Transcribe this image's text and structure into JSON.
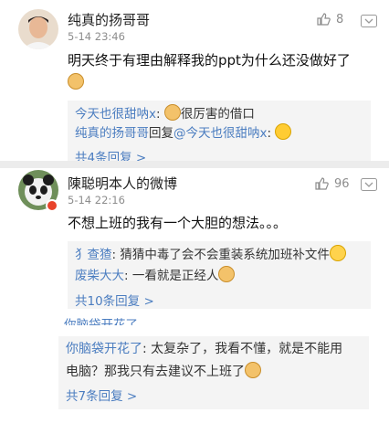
{
  "comments": [
    {
      "name": "纯真的扬哥哥",
      "date": "5-14 23:46",
      "likes": "8",
      "text": "明天终于有理由解释我的ppt为什么还没做好了",
      "replies": [
        {
          "name": "今天也很甜呐x",
          "sep": ":",
          "text": "很厉害的借口"
        },
        {
          "name": "纯真的扬哥哥",
          "sep": "回复",
          "name2": "@今天也很甜呐x",
          "sep2": ":"
        }
      ],
      "reply_count": "共4条回复 >"
    },
    {
      "name": "陳聪明本人的微博",
      "date": "5-14 22:16",
      "likes": "96",
      "text": "不想上班的我有一个大胆的想法。。。",
      "replies": [
        {
          "name": "犭查猹",
          "sep": ":",
          "text": "猜猜中毒了会不会重装系统加班补文件"
        },
        {
          "name": "废柴大大",
          "sep": ":",
          "text": "一看就是正经人"
        }
      ],
      "reply_count": "共10条回复 >"
    }
  ],
  "partial_reply": {
    "name": "你脑袋开花了",
    "sep": ":",
    "text": "太复杂了，我看不懂，就是不能用电脑？那我只有去建议不上班了"
  },
  "partial_line1": "你脑袋开花了: 太复杂了，我看不懂，就是不能用",
  "partial_line2": "电脑？那我只有去建议不上班了",
  "partial_count": "共7条回复 >",
  "clipped_header": "你脑袋开花了",
  "colors": {
    "link": "#4b7dc0",
    "muted": "#8d8d8d",
    "reply_bg": "#f4f4f4"
  },
  "icons": {
    "like": "thumbs-up-icon",
    "more": "chevron-down-icon"
  }
}
